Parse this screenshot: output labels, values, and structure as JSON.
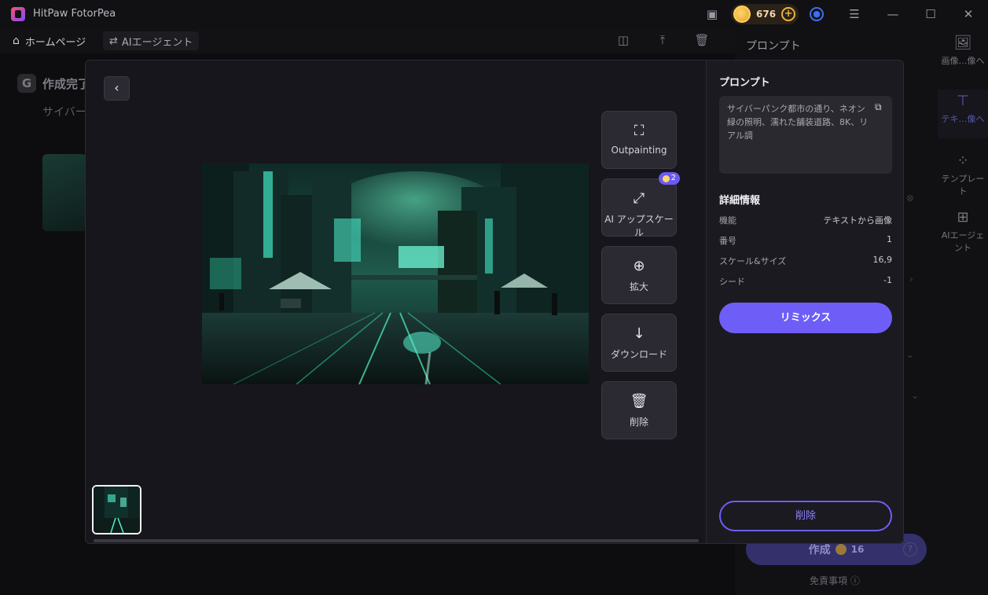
{
  "app": {
    "title": "HitPaw FotorPea",
    "coins": "676"
  },
  "nav": {
    "home_label": "ホームページ",
    "agent_label": "AIエージェント"
  },
  "background": {
    "page_title": "作成完了",
    "subtitle": "サイバーパ",
    "right_title": "プロンプト",
    "sidebar": [
      {
        "label": "画像…像へ"
      },
      {
        "label": "テキ…像へ"
      },
      {
        "label": "テンプレート"
      },
      {
        "label": "AIエージェント"
      }
    ],
    "create_label": "作成",
    "create_cost": "16",
    "disclaimer": "免責事項"
  },
  "viewer": {
    "actions": [
      {
        "label": "Outpainting",
        "icon": "outpainting-icon"
      },
      {
        "label": "AI アップスケール",
        "icon": "upscale-icon",
        "badge": "2"
      },
      {
        "label": "拡大",
        "icon": "zoom-in-icon"
      },
      {
        "label": "ダウンロード",
        "icon": "download-icon"
      },
      {
        "label": "削除",
        "icon": "trash-icon"
      }
    ]
  },
  "panel": {
    "prompt_heading": "プロンプト",
    "prompt_text": "サイバーパンク都市の通り、ネオン緑の照明、濡れた舗装道路、8K、リアル調",
    "details_heading": "詳細情報",
    "details": [
      {
        "key": "機能",
        "value": "テキストから画像"
      },
      {
        "key": "番号",
        "value": "1"
      },
      {
        "key": "スケール&サイズ",
        "value": "16,9"
      },
      {
        "key": "シード",
        "value": "-1"
      }
    ],
    "remix_label": "リミックス",
    "delete_label": "削除"
  },
  "colors": {
    "accent": "#6e5ef7",
    "surface": "#2b2a32",
    "panel": "#1b1a20"
  }
}
